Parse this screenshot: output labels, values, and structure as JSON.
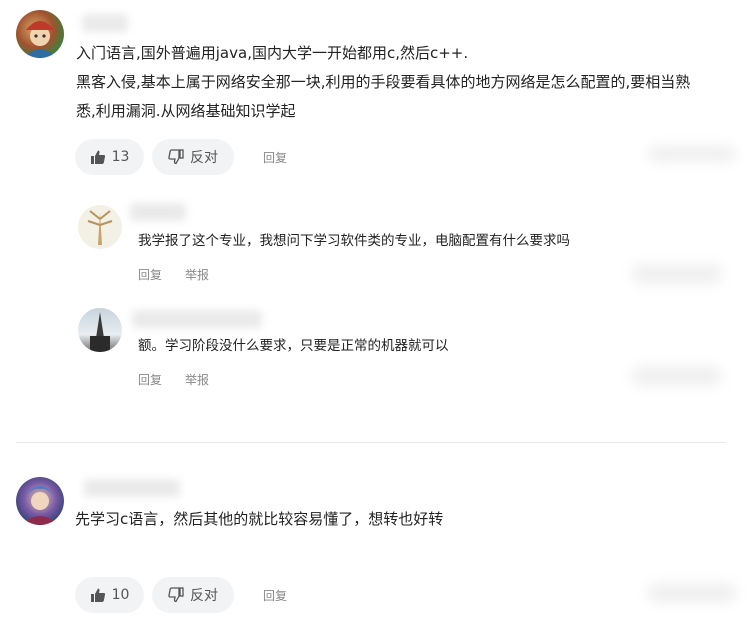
{
  "comments": [
    {
      "lines": [
        "入门语言,国外普遍用java,国内大学一开始都用c,然后c++.",
        "黑客入侵,基本上属于网络安全那一块,利用的手段要看具体的地方网络是怎么配置的,要相当熟",
        "悉,利用漏洞.从网络基础知识学起"
      ],
      "like_count": "13",
      "dislike_label": "反对",
      "reply_label": "回复",
      "replies": [
        {
          "text": "我学报了这个专业，我想问下学习软件类的专业，电脑配置有什么要求吗",
          "reply_label": "回复",
          "report_label": "举报"
        },
        {
          "text": "额。学习阶段没什么要求，只要是正常的机器就可以",
          "reply_label": "回复",
          "report_label": "举报"
        }
      ]
    },
    {
      "lines": [
        "先学习c语言，然后其他的就比较容易懂了，想转也好转"
      ],
      "like_count": "10",
      "dislike_label": "反对",
      "reply_label": "回复"
    }
  ],
  "icons": {
    "like": "thumbs-up-icon",
    "dislike": "thumbs-down-icon"
  },
  "colors": {
    "pill_bg": "#f2f3f5",
    "action_text": "#888888",
    "divider": "#e8e8e8"
  }
}
